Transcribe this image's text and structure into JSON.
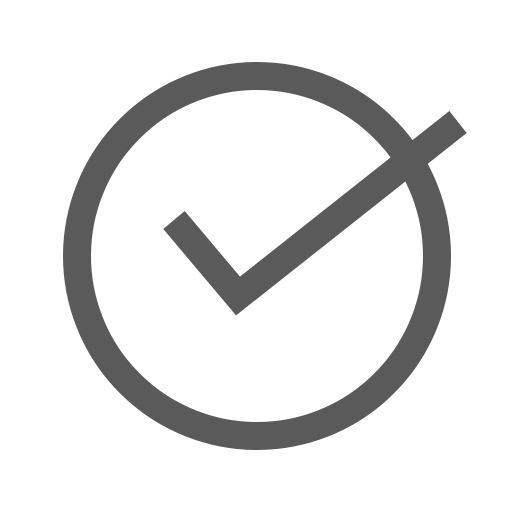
{
  "icon": {
    "name": "check-circle-icon",
    "stroke_color": "#5a5a5a",
    "background_color": "#ffffff"
  }
}
